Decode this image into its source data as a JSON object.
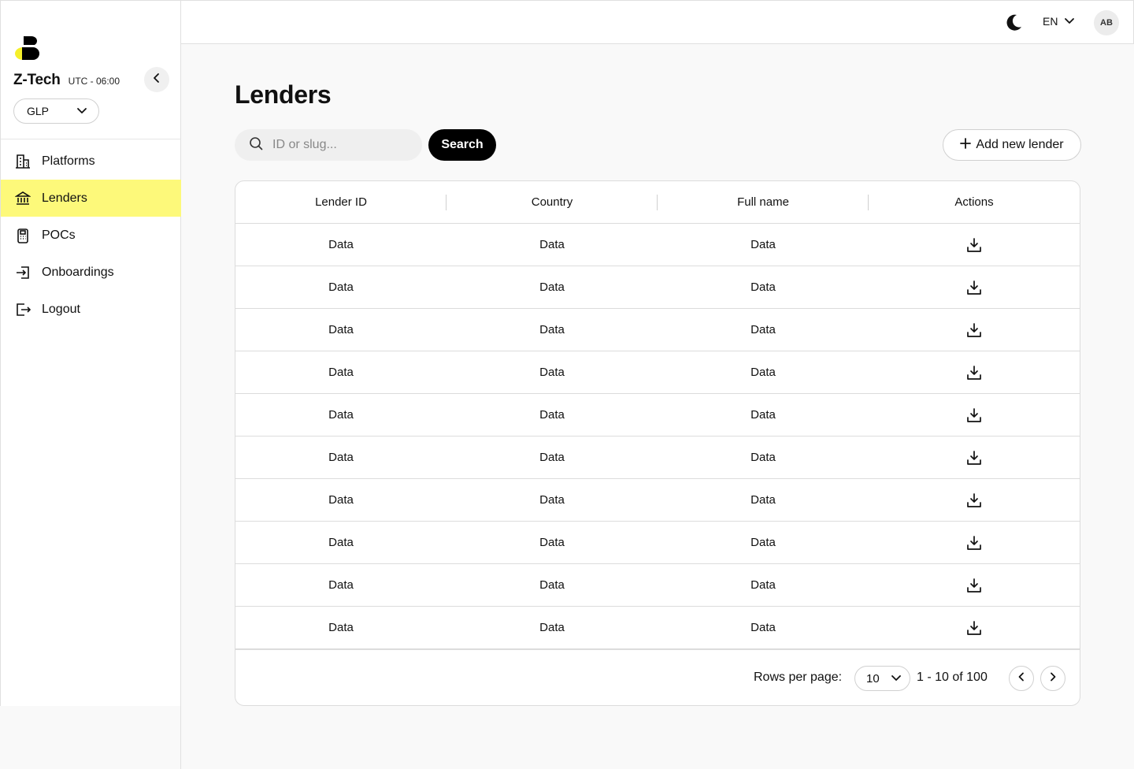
{
  "org": {
    "name": "Z-Tech",
    "timezone": "UTC - 06:00",
    "platform": "GLP"
  },
  "nav": [
    {
      "label": "Platforms",
      "icon": "building-icon",
      "active": false
    },
    {
      "label": "Lenders",
      "icon": "bank-icon",
      "active": true
    },
    {
      "label": "POCs",
      "icon": "pos-terminal-icon",
      "active": false
    },
    {
      "label": "Onboardings",
      "icon": "login-arrow-icon",
      "active": false
    },
    {
      "label": "Logout",
      "icon": "logout-icon",
      "active": false
    }
  ],
  "topbar": {
    "language": "EN",
    "avatar_initials": "AB"
  },
  "page": {
    "title": "Lenders"
  },
  "search": {
    "placeholder": "ID or slug...",
    "button_label": "Search"
  },
  "add_button_label": "Add new lender",
  "table": {
    "columns": [
      "Lender ID",
      "Country",
      "Full name",
      "Actions"
    ],
    "rows": [
      [
        "Data",
        "Data",
        "Data"
      ],
      [
        "Data",
        "Data",
        "Data"
      ],
      [
        "Data",
        "Data",
        "Data"
      ],
      [
        "Data",
        "Data",
        "Data"
      ],
      [
        "Data",
        "Data",
        "Data"
      ],
      [
        "Data",
        "Data",
        "Data"
      ],
      [
        "Data",
        "Data",
        "Data"
      ],
      [
        "Data",
        "Data",
        "Data"
      ],
      [
        "Data",
        "Data",
        "Data"
      ],
      [
        "Data",
        "Data",
        "Data"
      ]
    ]
  },
  "pagination": {
    "rows_per_page_label": "Rows per page:",
    "rows_per_page": "10",
    "range": "1 - 10 of 100"
  },
  "colors": {
    "accent": "#fdf97a",
    "logo_yellow": "#f5ef2a",
    "primary_button": "#000000"
  }
}
